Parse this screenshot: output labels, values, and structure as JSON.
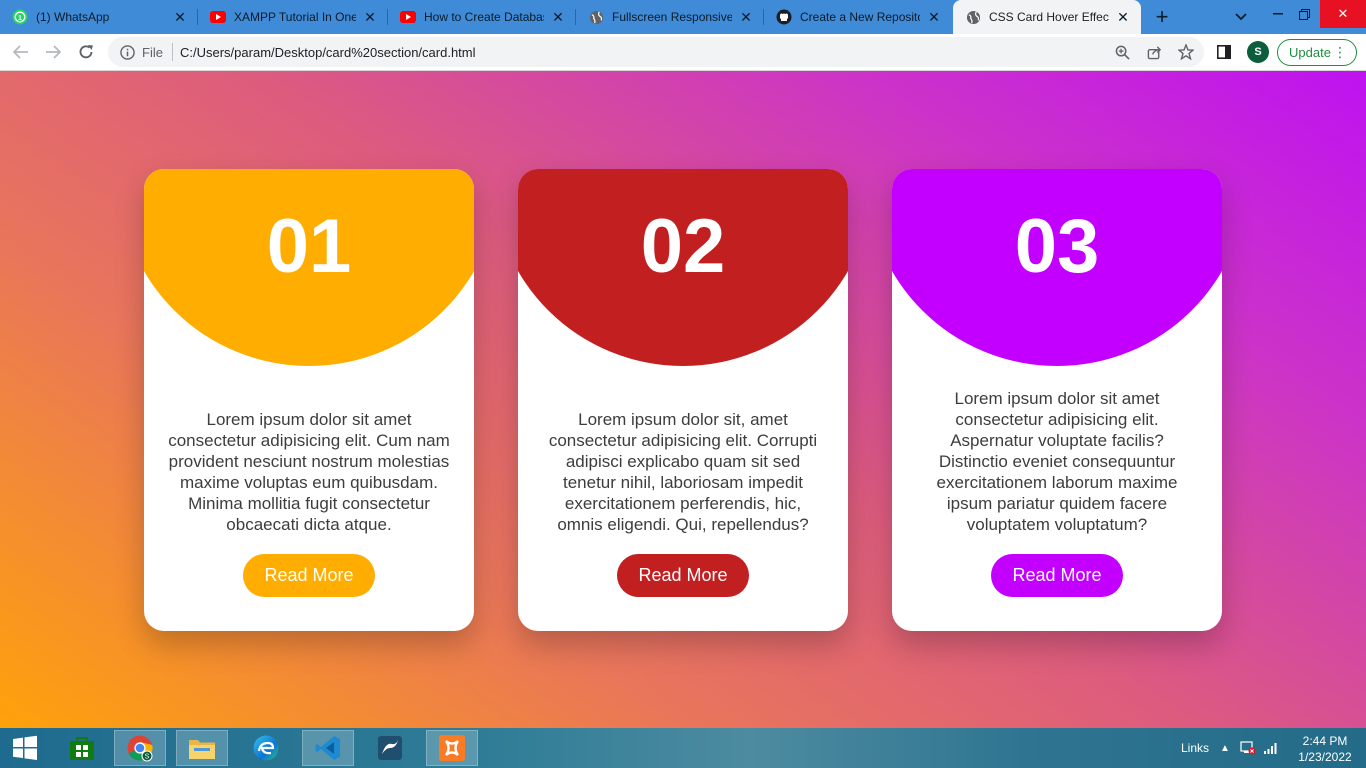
{
  "browser": {
    "tabs": [
      {
        "label": "(1) WhatsApp",
        "icon": "whatsapp-icon",
        "active": false
      },
      {
        "label": "XAMPP Tutorial In One",
        "icon": "youtube-icon",
        "active": false
      },
      {
        "label": "How to Create Databas",
        "icon": "youtube-icon",
        "active": false
      },
      {
        "label": "Fullscreen Responsive L",
        "icon": "globe-icon",
        "active": false
      },
      {
        "label": "Create a New Repositor",
        "icon": "github-icon",
        "active": false
      },
      {
        "label": "CSS Card Hover Effects",
        "icon": "globe-icon",
        "active": true
      }
    ],
    "address": {
      "scheme_label": "File",
      "url": "C:/Users/param/Desktop/card%20section/card.html"
    },
    "profile_initial": "S",
    "update_label": "Update"
  },
  "cards": [
    {
      "number": "01",
      "text": "Lorem ipsum dolor sit amet consectetur adipisicing elit. Cum nam provident nesciunt nostrum molestias maxime voluptas eum quibusdam. Minima mollitia fugit consectetur obcaecati dicta atque.",
      "button": "Read More",
      "color": "#ffad00"
    },
    {
      "number": "02",
      "text": "Lorem ipsum dolor sit, amet consectetur adipisicing elit. Corrupti adipisci explicabo quam sit sed tenetur nihil, laboriosam impedit exercitationem perferendis, hic, omnis eligendi. Qui, repellendus?",
      "button": "Read More",
      "color": "#c21f21"
    },
    {
      "number": "03",
      "text": "Lorem ipsum dolor sit amet consectetur adipisicing elit. Aspernatur voluptate facilis? Distinctio eveniet consequuntur exercitationem laborum maxime ipsum pariatur quidem facere voluptatem voluptatum?",
      "button": "Read More",
      "color": "#c300ff"
    }
  ],
  "taskbar": {
    "pinned": [
      "windows-start-icon",
      "store-icon",
      "chrome-icon",
      "file-explorer-icon",
      "edge-icon",
      "vscode-icon",
      "mysql-workbench-icon",
      "xampp-icon"
    ],
    "tray_links": "Links",
    "time": "2:44 PM",
    "date": "1/23/2022"
  }
}
